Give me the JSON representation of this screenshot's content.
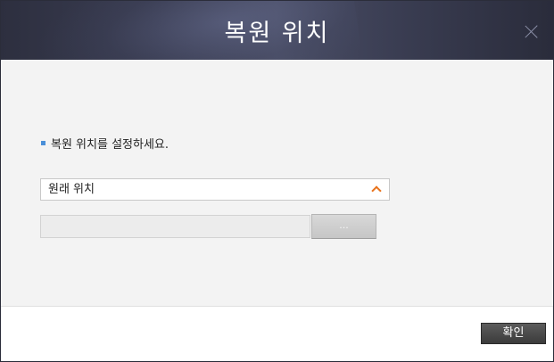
{
  "dialog": {
    "title": "복원 위치",
    "close_icon": "close-icon"
  },
  "body": {
    "instruction": "복원 위치를 설정하세요.",
    "location_select": {
      "selected": "원래 위치",
      "caret_icon": "chevron-up-icon"
    },
    "path_field": {
      "value": ""
    },
    "browse_label": "..."
  },
  "footer": {
    "ok_label": "확인"
  },
  "colors": {
    "titlebar": "#3a3d52",
    "body_bg": "#f3f3f3",
    "bullet": "#4a8fd8",
    "caret": "#e8731c",
    "ok_button": "#4a4a4a"
  }
}
